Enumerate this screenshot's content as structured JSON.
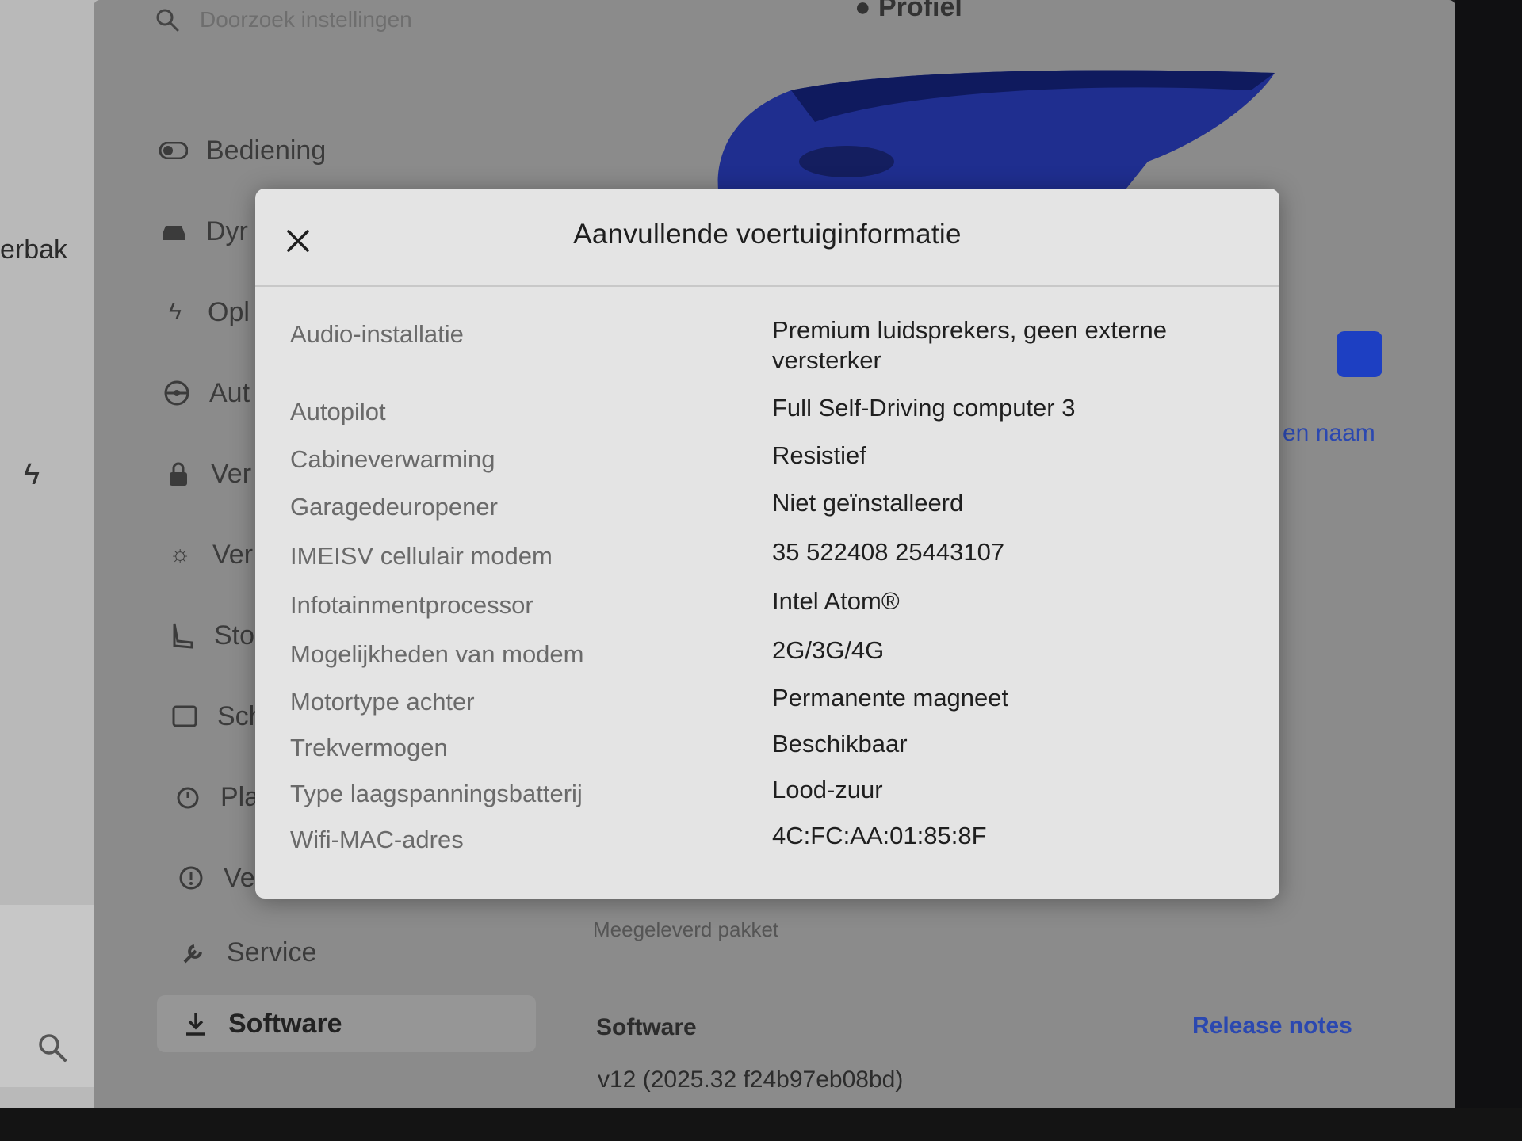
{
  "left_panel": {
    "partial_text": "erbak"
  },
  "settings": {
    "search_placeholder": "Doorzoek instellingen",
    "profile_label": "Profiel",
    "nav_items": [
      {
        "label": "Bediening",
        "icon": "toggle-icon"
      },
      {
        "label": "Dyr",
        "icon": "car-icon"
      },
      {
        "label": "Opl",
        "icon": "bolt-icon"
      },
      {
        "label": "Aut",
        "icon": "steering-wheel-icon"
      },
      {
        "label": "Ver",
        "icon": "lock-icon"
      },
      {
        "label": "Ver",
        "icon": "sun-icon"
      },
      {
        "label": "Sto",
        "icon": "seat-icon"
      },
      {
        "label": "Sch",
        "icon": "screen-icon"
      },
      {
        "label": "Pla",
        "icon": "alarm-clock-icon"
      },
      {
        "label": "Vei",
        "icon": "info-circle-icon"
      },
      {
        "label": "Service",
        "icon": "wrench-icon"
      },
      {
        "label": "Software",
        "icon": "download-icon"
      }
    ],
    "rename_link": "en naam",
    "package_label": "Meegeleverd pakket",
    "software_heading": "Software",
    "release_notes_link": "Release notes",
    "software_version": "v12 (2025.32 f24b97eb08bd)"
  },
  "modal": {
    "title": "Aanvullende voertuiginformatie",
    "rows": [
      {
        "label": "Audio-installatie",
        "value": "Premium luidsprekers, geen externe versterker"
      },
      {
        "label": "Autopilot",
        "value": "Full Self-Driving computer 3"
      },
      {
        "label": "Cabineverwarming",
        "value": "Resistief"
      },
      {
        "label": "Garagedeuropener",
        "value": "Niet geïnstalleerd"
      },
      {
        "label": "IMEISV cellulair modem",
        "value": "35 522408 25443107"
      },
      {
        "label": "Infotainmentprocessor",
        "value": "Intel Atom®"
      },
      {
        "label": "Mogelijkheden van modem",
        "value": "2G/3G/4G"
      },
      {
        "label": "Motortype achter",
        "value": "Permanente magneet"
      },
      {
        "label": "Trekvermogen",
        "value": "Beschikbaar"
      },
      {
        "label": "Type laagspanningsbatterij",
        "value": "Lood-zuur"
      },
      {
        "label": "Wifi-MAC-adres",
        "value": "4C:FC:AA:01:85:8F"
      }
    ]
  },
  "colors": {
    "modal_bg": "#e4e4e4",
    "link_blue": "#2b48b0",
    "badge_blue": "#1d3fc2"
  }
}
